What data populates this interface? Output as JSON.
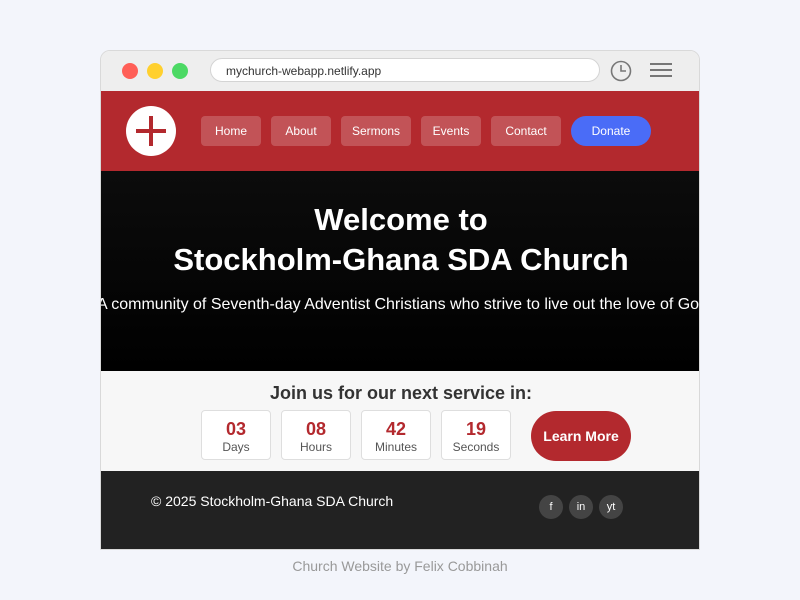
{
  "browser": {
    "url": "mychurch-webapp.netlify.app",
    "icons": [
      "clock-icon",
      "hamburger-menu-icon"
    ]
  },
  "nav": {
    "logo_icon": "cross-icon",
    "items": [
      {
        "label": "Home"
      },
      {
        "label": "About"
      },
      {
        "label": "Sermons"
      },
      {
        "label": "Events"
      },
      {
        "label": "Contact"
      }
    ],
    "donate_label": "Donate"
  },
  "hero": {
    "title_line1": "Welcome to",
    "title_line2": "Stockholm-Ghana SDA Church",
    "tagline": "A community of Seventh-day Adventist Christians who strive to live out the love of God"
  },
  "service": {
    "title": "Join us for our next service in:",
    "countdown": [
      {
        "value": "03",
        "unit": "Days"
      },
      {
        "value": "08",
        "unit": "Hours"
      },
      {
        "value": "42",
        "unit": "Minutes"
      },
      {
        "value": "19",
        "unit": "Seconds"
      }
    ],
    "learn_more_label": "Learn More"
  },
  "footer": {
    "copyright": "© 2025 Stockholm-Ghana SDA Church",
    "social": [
      {
        "label": "f",
        "icon": "facebook-icon"
      },
      {
        "label": "in",
        "icon": "linkedin-icon"
      },
      {
        "label": "yt",
        "icon": "youtube-icon"
      }
    ]
  },
  "credit": "Church Website by Felix Cobbinah",
  "colors": {
    "brand_red": "#b3292e",
    "donate_blue": "#4a6cf7",
    "footer_dark": "#222222"
  }
}
